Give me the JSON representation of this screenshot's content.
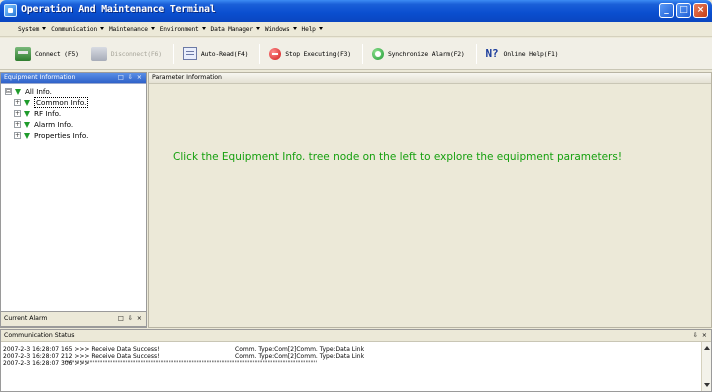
{
  "window": {
    "title": "Operation And Maintenance Terminal",
    "controls": {
      "minimize": "_",
      "maximize": "□",
      "close": "×"
    }
  },
  "menu": [
    {
      "label": "System"
    },
    {
      "label": "Communication"
    },
    {
      "label": "Maintenance"
    },
    {
      "label": "Environment"
    },
    {
      "label": "Data Manager"
    },
    {
      "label": "Windows"
    },
    {
      "label": "Help"
    }
  ],
  "toolbar": {
    "connect": "Connect (F5)",
    "disconnect": "Disconnect(F6)",
    "auto_read": "Auto-Read(F4)",
    "stop_executing": "Stop Executing(F3)",
    "sync_alarm": "Synchronize Alarm(F2)",
    "online_help": "Online Help(F1)",
    "help_icon_glyph": "N?"
  },
  "equipment_panel": {
    "title": "Equipment Information",
    "controls": "□ ⇩ ×",
    "tree": [
      {
        "label": "All Info.",
        "expander": "⊟"
      },
      {
        "label": "Common Info.",
        "expander": "+"
      },
      {
        "label": "RF Info.",
        "expander": "+"
      },
      {
        "label": "Alarm Info.",
        "expander": "+"
      },
      {
        "label": "Properties Info.",
        "expander": "+"
      }
    ]
  },
  "alarm_panel": {
    "title": "Current Alarm",
    "controls": "□ ⇩ ×"
  },
  "parameter_panel": {
    "title": "Parameter Information",
    "hint": "Click the Equipment Info. tree node on the left to explore the equipment parameters!"
  },
  "comm_panel": {
    "title": "Communication Status",
    "pin": "⇩ ×",
    "log": [
      {
        "left": "2007-2-3 16:28:07 165 >>> Receive Data Success!",
        "right": "Comm. Type:Com[2]Comm. Type:Data Link"
      },
      {
        "left": "2007-2-3 16:28:07 212 >>> Receive Data Success!",
        "right": "Comm. Type:Com[2]Comm. Type:Data Link"
      },
      {
        "left": "2007-2-3 16:28:07 306 >>>",
        "right": "''''''''''''''''''''''''''''''''''''''''''''''''''''''''''''''''''''''''''''''''''''''''''''''''''''''''''''''''''''''''''''''''''''''''''''''''''''''''''"
      }
    ]
  },
  "colors": {
    "hint_text": "#15a00e",
    "tree_icon": "#1f9c2c",
    "title_bar": "#0a4ecf"
  }
}
